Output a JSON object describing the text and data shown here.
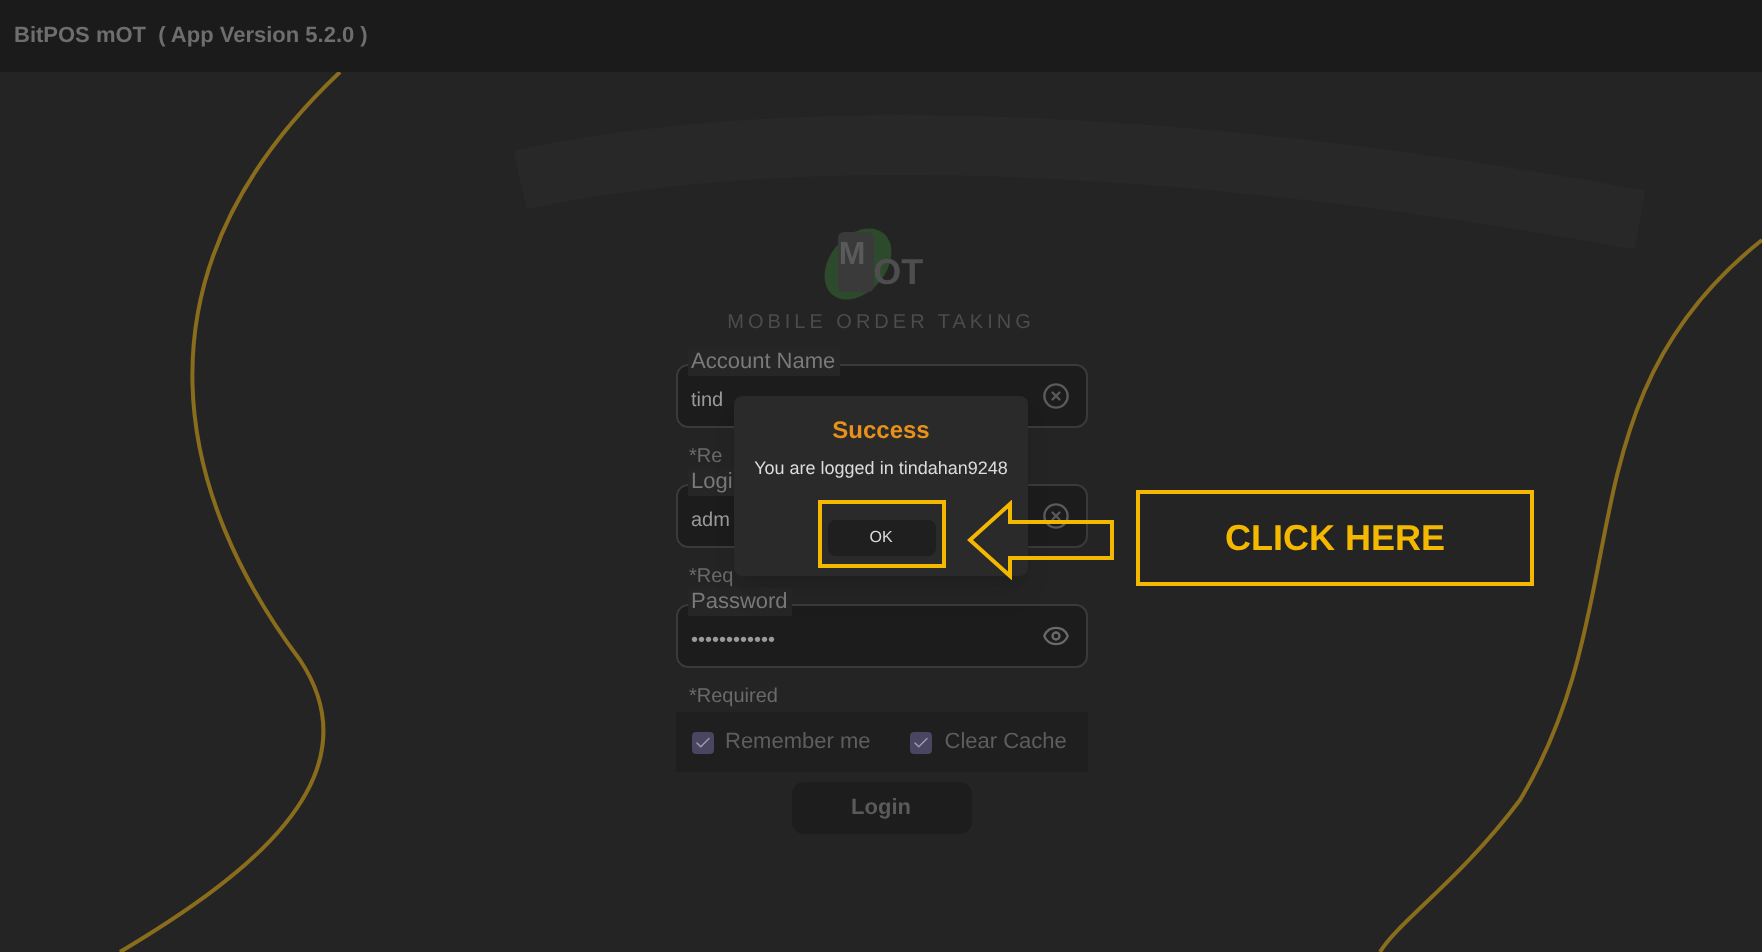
{
  "app_bar": {
    "title": "BitPOS mOT  ( App Version 5.2.0 )"
  },
  "logo": {
    "letter": "M",
    "text": "OT",
    "tagline": "MOBILE ORDER TAKING"
  },
  "fields": [
    {
      "label": "Account Name",
      "value": "tind",
      "hint": "*Re",
      "kind": "clear"
    },
    {
      "label": "Logi",
      "value": "adm",
      "hint": "*Req",
      "kind": "clear"
    },
    {
      "label": "Password",
      "value": "••••••••••••",
      "hint": "*Required",
      "kind": "reveal"
    }
  ],
  "checkboxes": [
    {
      "label": "Remember me",
      "checked": true
    },
    {
      "label": "Clear Cache",
      "checked": true
    }
  ],
  "login_button": "Login",
  "dialog": {
    "title": "Success",
    "message": "You are logged in tindahan9248",
    "button": "OK"
  },
  "annotation": {
    "text": "CLICK HERE"
  }
}
